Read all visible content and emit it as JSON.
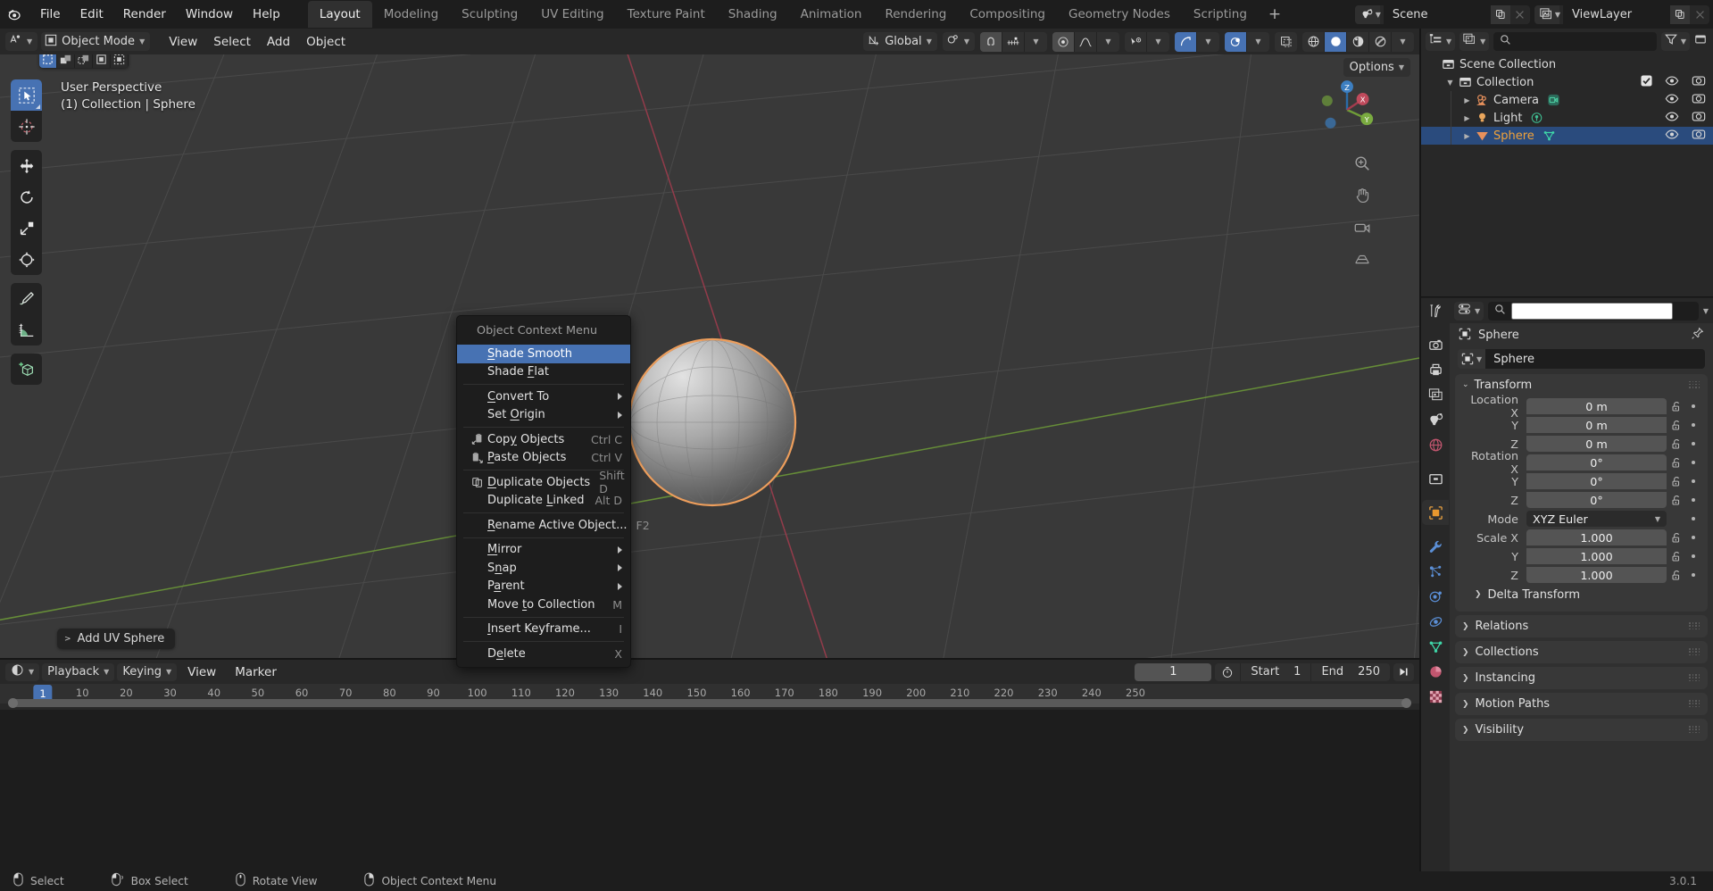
{
  "app": {
    "version": "3.0.1"
  },
  "topbar": {
    "logo_icon": "blender-logo-icon",
    "menus": [
      "File",
      "Edit",
      "Render",
      "Window",
      "Help"
    ],
    "workspaces": [
      {
        "label": "Layout",
        "active": true
      },
      {
        "label": "Modeling",
        "active": false
      },
      {
        "label": "Sculpting",
        "active": false
      },
      {
        "label": "UV Editing",
        "active": false
      },
      {
        "label": "Texture Paint",
        "active": false
      },
      {
        "label": "Shading",
        "active": false
      },
      {
        "label": "Animation",
        "active": false
      },
      {
        "label": "Rendering",
        "active": false
      },
      {
        "label": "Compositing",
        "active": false
      },
      {
        "label": "Geometry Nodes",
        "active": false
      },
      {
        "label": "Scripting",
        "active": false
      }
    ],
    "add_workspace_label": "+",
    "scene": {
      "name": "Scene",
      "icon": "scene-icon",
      "new_icon": "duplicate-icon",
      "unlink_icon": "close-icon"
    },
    "viewlayer": {
      "name": "ViewLayer",
      "icon": "view-layer-icon",
      "new_icon": "duplicate-icon",
      "unlink_icon": "close-icon"
    }
  },
  "viewport_header": {
    "editor_type_icon": "editor-type-3dview-icon",
    "mode": "Object Mode",
    "mode_icon": "object-mode-icon",
    "menus": [
      "View",
      "Select",
      "Add",
      "Object"
    ],
    "transform_orientation": "Global",
    "transform_orientation_icon": "orientation-gizmo-icon",
    "snap_icon": "snap-magnet-icon",
    "snap_target_icon": "snap-increment-icon",
    "proportional_icon": "proportional-edit-icon",
    "proportional_falloff_icon": "falloff-curve-icon",
    "gizmo_visibility_icon": "show-gizmo-icon",
    "overlays_icon": "overlays-icon",
    "xray_icon": "xray-toggle-icon",
    "shading_modes": [
      "wireframe",
      "solid",
      "material-preview",
      "rendered"
    ],
    "shading_active": "solid"
  },
  "viewport": {
    "tool_header_modes": [
      "set-select",
      "extend-select",
      "subtract-select",
      "invert-select",
      "intersect-select"
    ],
    "tool_header_active": 0,
    "options_label": "Options",
    "perspective_label": "User Perspective",
    "context_label": "(1) Collection | Sphere",
    "tools": [
      {
        "name": "tweak-tool",
        "icon": "cursor-arrow-icon",
        "active": true
      },
      {
        "name": "cursor-tool",
        "icon": "3d-cursor-icon",
        "active": false
      },
      {
        "name": "move-tool",
        "icon": "move-arrows-icon",
        "active": false
      },
      {
        "name": "rotate-tool",
        "icon": "rotate-icon",
        "active": false
      },
      {
        "name": "scale-tool",
        "icon": "scale-icon",
        "active": false
      },
      {
        "name": "transform-tool",
        "icon": "transform-icon",
        "active": false
      },
      {
        "name": "annotate-tool",
        "icon": "pencil-icon",
        "active": false
      },
      {
        "name": "measure-tool",
        "icon": "ruler-icon",
        "active": false
      },
      {
        "name": "add-cube-tool",
        "icon": "add-cube-icon",
        "active": false
      }
    ],
    "gizmo_axes": [
      "X",
      "Y",
      "Z"
    ],
    "nav_buttons": [
      "zoom-icon",
      "pan-hand-icon",
      "camera-view-icon",
      "toggle-perspective-icon"
    ],
    "last_operator": "Add UV Sphere",
    "last_operator_chevron": ">"
  },
  "context_menu": {
    "title": "Object Context Menu",
    "groups": [
      [
        {
          "label": "Shade Smooth",
          "underline": "S",
          "highlighted": true,
          "icon": null,
          "shortcut": null,
          "submenu": false
        },
        {
          "label": "Shade Flat",
          "underline": "F",
          "highlighted": false,
          "icon": null,
          "shortcut": null,
          "submenu": false
        }
      ],
      [
        {
          "label": "Convert To",
          "underline": "C",
          "highlighted": false,
          "icon": null,
          "shortcut": null,
          "submenu": true
        },
        {
          "label": "Set Origin",
          "underline": "O",
          "highlighted": false,
          "icon": null,
          "shortcut": null,
          "submenu": true
        }
      ],
      [
        {
          "label": "Copy Objects",
          "underline": "y",
          "highlighted": false,
          "icon": "copy-icon",
          "shortcut": "Ctrl C",
          "submenu": false
        },
        {
          "label": "Paste Objects",
          "underline": "P",
          "highlighted": false,
          "icon": "paste-icon",
          "shortcut": "Ctrl V",
          "submenu": false
        }
      ],
      [
        {
          "label": "Duplicate Objects",
          "underline": "D",
          "highlighted": false,
          "icon": "duplicate-icon",
          "shortcut": "Shift D",
          "submenu": false
        },
        {
          "label": "Duplicate Linked",
          "underline": "L",
          "highlighted": false,
          "icon": null,
          "shortcut": "Alt D",
          "submenu": false
        }
      ],
      [
        {
          "label": "Rename Active Object...",
          "underline": "R",
          "highlighted": false,
          "icon": null,
          "shortcut": "F2",
          "submenu": false
        }
      ],
      [
        {
          "label": "Mirror",
          "underline": "M",
          "highlighted": false,
          "icon": null,
          "shortcut": null,
          "submenu": true
        },
        {
          "label": "Snap",
          "underline": "n",
          "highlighted": false,
          "icon": null,
          "shortcut": null,
          "submenu": true
        },
        {
          "label": "Parent",
          "underline": "a",
          "highlighted": false,
          "icon": null,
          "shortcut": null,
          "submenu": true
        },
        {
          "label": "Move to Collection",
          "underline": "t",
          "highlighted": false,
          "icon": null,
          "shortcut": "M",
          "submenu": false
        }
      ],
      [
        {
          "label": "Insert Keyframe...",
          "underline": "I",
          "highlighted": false,
          "icon": null,
          "shortcut": "I",
          "submenu": false
        }
      ],
      [
        {
          "label": "Delete",
          "underline": "e",
          "highlighted": false,
          "icon": null,
          "shortcut": "X",
          "submenu": false
        }
      ]
    ]
  },
  "outliner": {
    "display_mode_icon": "outliner-display-icon",
    "filter_id_icon": "view-layer-icon",
    "search_placeholder": "",
    "search_icon": "search-icon",
    "filter_icon": "filter-funnel-icon",
    "rows": [
      {
        "name": "Scene Collection",
        "icon": "collection-icon",
        "indent": 0,
        "disclosure": "",
        "selected": false,
        "data_icon": null,
        "checkbox": false,
        "eye": false,
        "camera": false
      },
      {
        "name": "Collection",
        "icon": "collection-icon",
        "indent": 1,
        "disclosure": "down",
        "selected": false,
        "data_icon": null,
        "checkbox": true,
        "eye": true,
        "camera": true
      },
      {
        "name": "Camera",
        "icon": "camera-object-icon",
        "indent": 2,
        "disclosure": "right",
        "selected": false,
        "data_icon": "camera-data-icon",
        "checkbox": false,
        "eye": true,
        "camera": true
      },
      {
        "name": "Light",
        "icon": "light-object-icon",
        "indent": 2,
        "disclosure": "right",
        "selected": false,
        "data_icon": "light-data-icon",
        "checkbox": false,
        "eye": true,
        "camera": true
      },
      {
        "name": "Sphere",
        "icon": "mesh-object-icon",
        "indent": 2,
        "disclosure": "right",
        "selected": true,
        "data_icon": "mesh-data-icon",
        "checkbox": false,
        "eye": true,
        "camera": true
      }
    ]
  },
  "properties": {
    "editor_icon": "properties-editor-icon",
    "search_placeholder": "",
    "search_icon": "search-icon",
    "breadcrumb": "Sphere",
    "breadcrumb_icon": "object-icon",
    "pin_icon": "pin-icon",
    "id_name": "Sphere",
    "id_icon": "object-icon",
    "tabs": [
      {
        "name": "tool",
        "icon": "tool-icon",
        "selected": false
      },
      {
        "name": "render",
        "icon": "render-camera-icon",
        "selected": false
      },
      {
        "name": "output",
        "icon": "output-printer-icon",
        "selected": false
      },
      {
        "name": "view-layer",
        "icon": "view-layer-images-icon",
        "selected": false
      },
      {
        "name": "scene",
        "icon": "scene-cone-icon",
        "selected": false
      },
      {
        "name": "world",
        "icon": "world-globe-icon",
        "selected": false
      },
      {
        "name": "collection",
        "icon": "collection-box-icon",
        "selected": false
      },
      {
        "name": "object",
        "icon": "object-square-icon",
        "selected": true
      },
      {
        "name": "modifiers",
        "icon": "wrench-icon",
        "selected": false
      },
      {
        "name": "particles",
        "icon": "particles-icon",
        "selected": false
      },
      {
        "name": "physics",
        "icon": "physics-orbit-icon",
        "selected": false
      },
      {
        "name": "constraints",
        "icon": "constraints-icon",
        "selected": false
      },
      {
        "name": "object-data",
        "icon": "mesh-data-triangle-icon",
        "selected": false
      },
      {
        "name": "material",
        "icon": "material-sphere-icon",
        "selected": false
      },
      {
        "name": "texture",
        "icon": "texture-checker-icon",
        "selected": false
      }
    ],
    "transform": {
      "title": "Transform",
      "expanded": true,
      "rows": [
        {
          "label": "Location X",
          "value": "0 m"
        },
        {
          "label": "Y",
          "value": "0 m"
        },
        {
          "label": "Z",
          "value": "0 m"
        },
        {
          "label": "Rotation X",
          "value": "0°"
        },
        {
          "label": "Y",
          "value": "0°"
        },
        {
          "label": "Z",
          "value": "0°"
        }
      ],
      "mode_label": "Mode",
      "mode_value": "XYZ Euler",
      "scale_rows": [
        {
          "label": "Scale X",
          "value": "1.000"
        },
        {
          "label": "Y",
          "value": "1.000"
        },
        {
          "label": "Z",
          "value": "1.000"
        }
      ],
      "delta_transform_label": "Delta Transform"
    },
    "closed_panels": [
      "Relations",
      "Collections",
      "Instancing",
      "Motion Paths",
      "Visibility"
    ]
  },
  "timeline": {
    "editor_icon": "timeline-editor-icon",
    "dropdowns": [
      "Playback",
      "Keying"
    ],
    "menus": [
      "View",
      "Marker"
    ],
    "current_frame": "1",
    "timer_icon": "stopwatch-icon",
    "start_label": "Start",
    "start_value": "1",
    "end_label": "End",
    "end_value": "250",
    "jump_end_icon": "jump-to-end-icon",
    "ticks": [
      "1",
      "10",
      "20",
      "30",
      "40",
      "50",
      "60",
      "70",
      "80",
      "90",
      "100",
      "110",
      "120",
      "130",
      "140",
      "150",
      "160",
      "170",
      "180",
      "190",
      "200",
      "210",
      "220",
      "230",
      "240",
      "250"
    ],
    "playhead_frame": "1"
  },
  "statusbar": {
    "items": [
      {
        "icon": "mouse-left-icon",
        "label": "Select"
      },
      {
        "icon": "mouse-left-drag-icon",
        "label": "Box Select"
      },
      {
        "icon": "mouse-middle-icon",
        "label": "Rotate View"
      },
      {
        "icon": "mouse-right-icon",
        "label": "Object Context Menu"
      }
    ],
    "version": "3.0.1"
  },
  "colors": {
    "accent_blue": "#4772b3",
    "viewport_bg": "#393939",
    "panel_bg": "#303030",
    "header_bg": "#282828",
    "dark_bg": "#1d1d1d",
    "axis_x": "#a33c4e",
    "axis_y": "#6e9c38",
    "sphere_outline": "#ed9e5c",
    "text": "#d8d8d8"
  }
}
